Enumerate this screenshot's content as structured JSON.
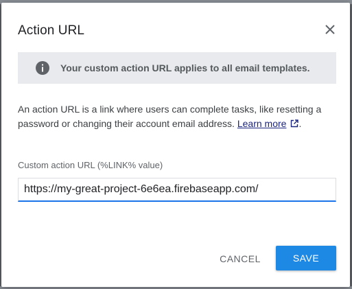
{
  "dialog": {
    "title": "Action URL",
    "banner_text": "Your custom action URL applies to all email templates.",
    "description": "An action URL is a link where users can complete tasks, like resetting a password or changing their account email address.",
    "learn_more_label": "Learn more",
    "description_end": ".",
    "field_label": "Custom action URL (%LINK% value)",
    "field_value": "https://my-great-project-6e6ea.firebaseapp.com/",
    "cancel_label": "CANCEL",
    "save_label": "SAVE"
  },
  "icons": {
    "close": "close-icon",
    "info": "info-icon",
    "external_link": "external-link-icon"
  },
  "colors": {
    "primary": "#1e88e5",
    "banner_bg": "#e8eaed",
    "link": "#1a237e"
  }
}
